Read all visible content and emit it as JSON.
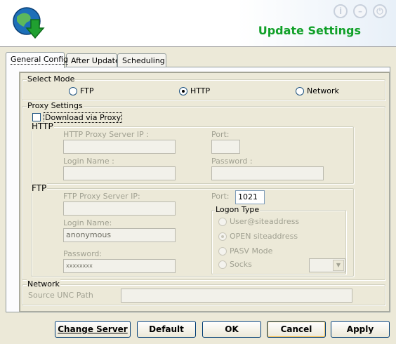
{
  "header": {
    "title": "Update Settings",
    "icons": [
      "info-icon",
      "minimize-icon",
      "power-icon"
    ]
  },
  "tabs": [
    {
      "label": "General Config",
      "active": true
    },
    {
      "label": "After Update",
      "active": false
    },
    {
      "label": "Scheduling",
      "active": false
    }
  ],
  "select_mode": {
    "legend": "Select Mode",
    "options": [
      {
        "label": "FTP",
        "checked": false
      },
      {
        "label": "HTTP",
        "checked": true
      },
      {
        "label": "Network",
        "checked": false
      }
    ]
  },
  "proxy": {
    "legend": "Proxy Settings",
    "download_via_proxy": "Download via Proxy",
    "http": {
      "legend": "HTTP",
      "server_ip_label": "HTTP Proxy Server IP :",
      "port_label": "Port:",
      "login_label": "Login Name :",
      "password_label": "Password :"
    },
    "ftp": {
      "legend": "FTP",
      "server_ip_label": "FTP Proxy Server IP:",
      "port_label": "Port:",
      "port_value": "1021",
      "login_label": "Login Name:",
      "login_value": "anonymous",
      "password_label": "Password:",
      "password_value": "xxxxxxxx",
      "logon_type": {
        "legend": "Logon Type",
        "options": [
          {
            "label": "User@siteaddress",
            "checked": false
          },
          {
            "label": "OPEN siteaddress",
            "checked": true
          },
          {
            "label": "PASV Mode",
            "checked": false
          },
          {
            "label": "Socks",
            "checked": false
          }
        ]
      }
    }
  },
  "network": {
    "legend": "Network",
    "unc_label": "Source UNC Path"
  },
  "buttons": {
    "change_server": "Change Server",
    "default": "Default",
    "ok": "OK",
    "cancel": "Cancel",
    "apply": "Apply"
  },
  "colors": {
    "title": "#10a028",
    "background": "#ece9d8",
    "button_border": "#003c74"
  }
}
